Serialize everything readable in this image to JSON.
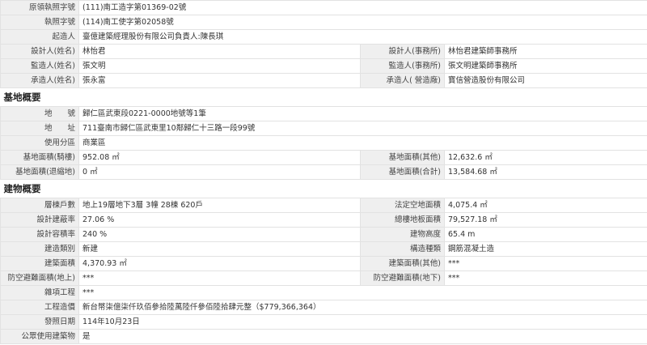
{
  "top_rows": [
    {
      "label": "原領執照字號",
      "value": "(111)南工造字第01369-02號"
    },
    {
      "label": "執照字號",
      "value": "(114)南工使字第02058號"
    },
    {
      "label": "起造人",
      "value": "臺億建築經理股份有限公司負責人:陳長琪"
    }
  ],
  "pair_rows_1": [
    {
      "l1": "設計人(姓名)",
      "v1": "林怡君",
      "l2": "設計人(事務所)",
      "v2": "林怡君建築師事務所"
    },
    {
      "l1": "監造人(姓名)",
      "v1": "張文明",
      "l2": "監造人(事務所)",
      "v2": "張文明建築師事務所"
    },
    {
      "l1": "承造人(姓名)",
      "v1": "張永富",
      "l2": "承造人( 營造廠)",
      "v2": "寶信營造股份有限公司"
    }
  ],
  "site_section": {
    "title": "基地概要",
    "address_rows": [
      {
        "label": "地　　號",
        "value": "歸仁區武東段0221-0000地號等1筆"
      },
      {
        "label": "地　　址",
        "value": "711臺南市歸仁區武東里10鄰歸仁十三路一段99號"
      },
      {
        "label": "使用分區",
        "value": "商業區"
      }
    ],
    "pair_rows": [
      {
        "l1": "基地面積(騎樓)",
        "v1": "952.08 ㎡",
        "l2": "基地面積(其他)",
        "v2": "12,632.6 ㎡"
      },
      {
        "l1": "基地面積(退縮地)",
        "v1": "0 ㎡",
        "l2": "基地面積(合計)",
        "v2": "13,584.68 ㎡"
      }
    ]
  },
  "building_section": {
    "title": "建物概要",
    "pair_rows": [
      {
        "l1": "層棟戶數",
        "v1": "地上19層地下3層 3幢 28棟 620戶",
        "l2": "法定空地面積",
        "v2": "4,075.4 ㎡"
      },
      {
        "l1": "設計建蔽率",
        "v1": "27.06 %",
        "l2": "總樓地板面積",
        "v2": "79,527.18 ㎡"
      },
      {
        "l1": "設計容積率",
        "v1": "240 %",
        "l2": "建物高度",
        "v2": "65.4 m"
      },
      {
        "l1": "建造類別",
        "v1": "新建",
        "l2": "構造種類",
        "v2": "鋼筋混凝土造"
      },
      {
        "l1": "建築面積",
        "v1": "4,370.93 ㎡",
        "l2": "建築面積(其他)",
        "v2": "***"
      },
      {
        "l1": "防空避難面積(地上)",
        "v1": "***",
        "l2": "防空避難面積(地下)",
        "v2": "***"
      }
    ],
    "single_rows": [
      {
        "label": "雜項工程",
        "value": "***"
      },
      {
        "label": "工程造價",
        "value": "新台幣柒億柒仟玖佰參拾陸萬陸仟參佰陸拾肆元整（$779,366,364）"
      },
      {
        "label": "發照日期",
        "value": "114年10月23日"
      },
      {
        "label": "公眾使用建築物",
        "value": "是"
      }
    ]
  }
}
